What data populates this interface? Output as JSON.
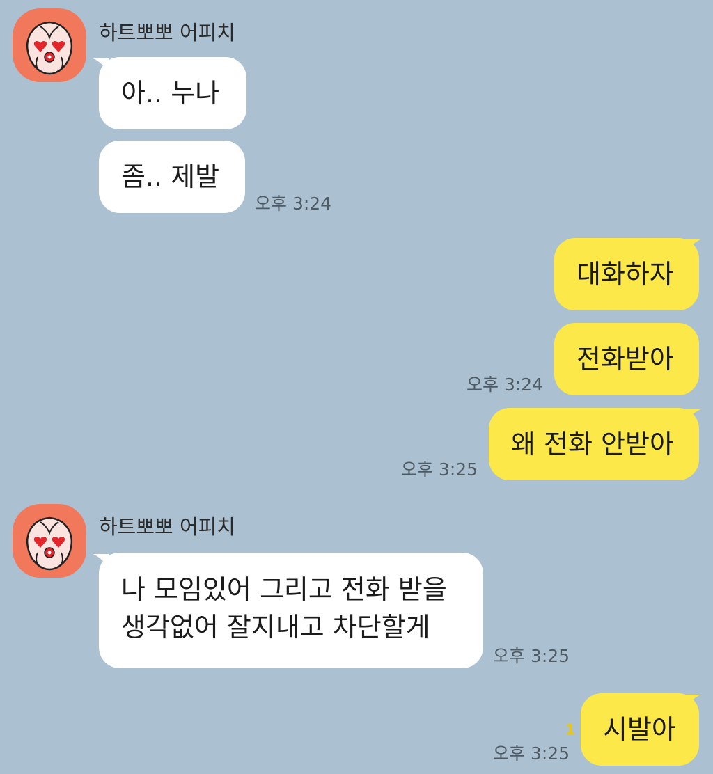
{
  "colors": {
    "background": "#abc1d1",
    "incoming_bubble": "#ffffff",
    "outgoing_bubble": "#fde84a",
    "avatar": "#f2785c",
    "unread": "#e6c51c"
  },
  "contact": {
    "name": "하트뽀뽀 어피치",
    "avatar_icon": "apeach-heart-eyes-icon"
  },
  "messages": [
    {
      "dir": "in",
      "text": "아.. 누나"
    },
    {
      "dir": "in",
      "text": "좀..  제발",
      "time": "오후 3:24"
    },
    {
      "dir": "out",
      "text": "대화하자"
    },
    {
      "dir": "out",
      "text": "전화받아",
      "time": "오후 3:24"
    },
    {
      "dir": "out",
      "text": "왜 전화 안받아",
      "time": "오후 3:25"
    },
    {
      "dir": "in",
      "lines": [
        "나 모임있어 그리고 전화 받을",
        "생각없어 잘지내고 차단할게"
      ],
      "time": "오후 3:25"
    },
    {
      "dir": "out",
      "text": "시발아",
      "time": "오후 3:25",
      "unread": "1"
    }
  ]
}
